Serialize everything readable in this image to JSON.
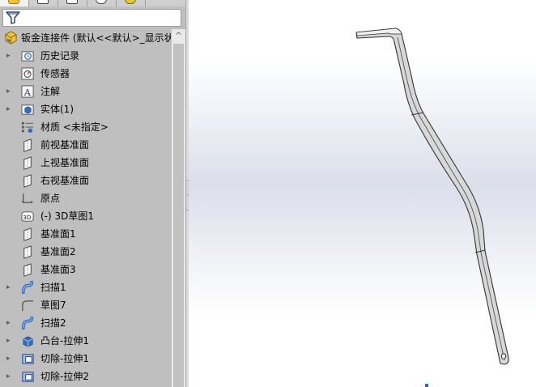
{
  "tree": {
    "root_label": "钣金连接件  (默认<<默认>_显示状",
    "items": [
      {
        "label": "历史记录",
        "icon": "history-folder-icon",
        "expandable": true
      },
      {
        "label": "传感器",
        "icon": "sensor-icon",
        "expandable": false
      },
      {
        "label": "注解",
        "icon": "annotation-icon",
        "expandable": true
      },
      {
        "label": "实体(1)",
        "icon": "solid-bodies-icon",
        "expandable": true
      },
      {
        "label": "材质 <未指定>",
        "icon": "material-icon",
        "expandable": false
      },
      {
        "label": "前视基准面",
        "icon": "plane-icon",
        "expandable": false
      },
      {
        "label": "上视基准面",
        "icon": "plane-icon",
        "expandable": false
      },
      {
        "label": "右视基准面",
        "icon": "plane-icon",
        "expandable": false
      },
      {
        "label": "原点",
        "icon": "origin-icon",
        "expandable": false
      },
      {
        "label": "(-) 3D草图1",
        "icon": "3d-sketch-icon",
        "expandable": false
      },
      {
        "label": "基准面1",
        "icon": "plane-icon",
        "expandable": false
      },
      {
        "label": "基准面2",
        "icon": "plane-icon",
        "expandable": false
      },
      {
        "label": "基准面3",
        "icon": "plane-icon",
        "expandable": false
      },
      {
        "label": "扫描1",
        "icon": "sweep-icon",
        "expandable": true
      },
      {
        "label": "草图7",
        "icon": "sketch-icon",
        "expandable": false
      },
      {
        "label": "扫描2",
        "icon": "sweep-icon",
        "expandable": true
      },
      {
        "label": "凸台-拉伸1",
        "icon": "boss-extrude-icon",
        "expandable": true
      },
      {
        "label": "切除-拉伸1",
        "icon": "cut-extrude-icon",
        "expandable": true
      },
      {
        "label": "切除-拉伸2",
        "icon": "cut-extrude-icon",
        "expandable": true
      }
    ]
  },
  "icons": {
    "expand_arrow": "▸",
    "scroll_up": "^",
    "splitter_handle": "‹"
  },
  "colors": {
    "panel_bg": "#bfbfbf",
    "part_fill": "#d6d6d6",
    "part_edge": "#3a3a3a",
    "icon_blue": "#2f6fc9"
  }
}
